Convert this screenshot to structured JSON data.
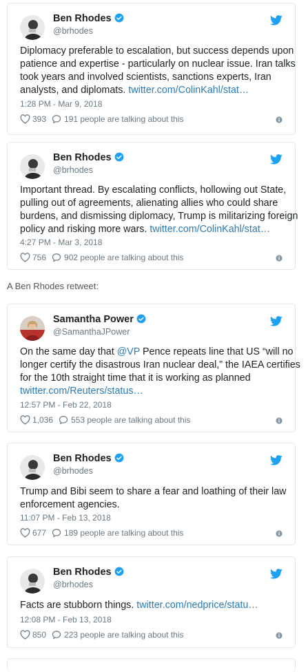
{
  "colors": {
    "link": "#2b7bb9",
    "verified": "#1da1f2",
    "muted": "#697882",
    "border": "#e1e8ed"
  },
  "icons": {
    "verified": "verified-badge-icon",
    "twitter": "twitter-bird-icon",
    "like": "heart-icon",
    "reply": "speech-bubble-icon",
    "info": "info-icon"
  },
  "retweet_label": "A Ben Rhodes retweet:",
  "tweets": [
    {
      "name": "Ben Rhodes",
      "handle": "@brhodes",
      "lines": [
        "Diplomacy preferable to escalation, but success depends upon",
        "patience and expertise - particularly on nuclear issue. Iran talks",
        "took years and involved scientists, sanctions experts, Iran"
      ],
      "last_line_text": "analysts, and diplomats. ",
      "last_line_link": "twitter.com/ColinKahl/stat…",
      "time": "1:28 PM - Mar 9, 2018",
      "likes": "393",
      "talking": "191 people are talking about this"
    },
    {
      "name": "Ben Rhodes",
      "handle": "@brhodes",
      "lines": [
        "Important thread. By escalating conflicts, hollowing out State,",
        "pulling out of agreements, alienating allies who could share",
        "burdens, and dismissing diplomacy, Trump is militarizing foreign"
      ],
      "last_line_text": "policy and risking more wars. ",
      "last_line_link": "twitter.com/ColinKahl/stat…",
      "time": "4:27 PM - Mar 3, 2018",
      "likes": "756",
      "talking": "902 people are talking about this"
    },
    {
      "name": "Samantha Power",
      "handle": "@SamanthaJPower",
      "line1_pre": "On the same day that ",
      "line1_mention": "@VP",
      "line1_post": " Pence repeats line that US “will no",
      "lines": [
        "longer certify the disastrous Iran nuclear deal,” the IAEA certifies",
        "for the 10th straight time that it is working as planned"
      ],
      "last_line_link": "twitter.com/Reuters/status…",
      "time": "12:57 PM - Feb 22, 2018",
      "likes": "1,036",
      "talking": "553 people are talking about this"
    },
    {
      "name": "Ben Rhodes",
      "handle": "@brhodes",
      "lines": [
        "Trump and Bibi seem to share a fear and loathing of their law",
        "enforcement agencies."
      ],
      "time": "11:07 PM - Feb 13, 2018",
      "likes": "677",
      "talking": "189 people are talking about this"
    },
    {
      "name": "Ben Rhodes",
      "handle": "@brhodes",
      "last_line_text": "Facts are stubborn things. ",
      "last_line_link": "twitter.com/nedprice/statu…",
      "time": "12:08 PM - Feb 13, 2018",
      "likes": "850",
      "talking": "223 people are talking about this"
    }
  ]
}
